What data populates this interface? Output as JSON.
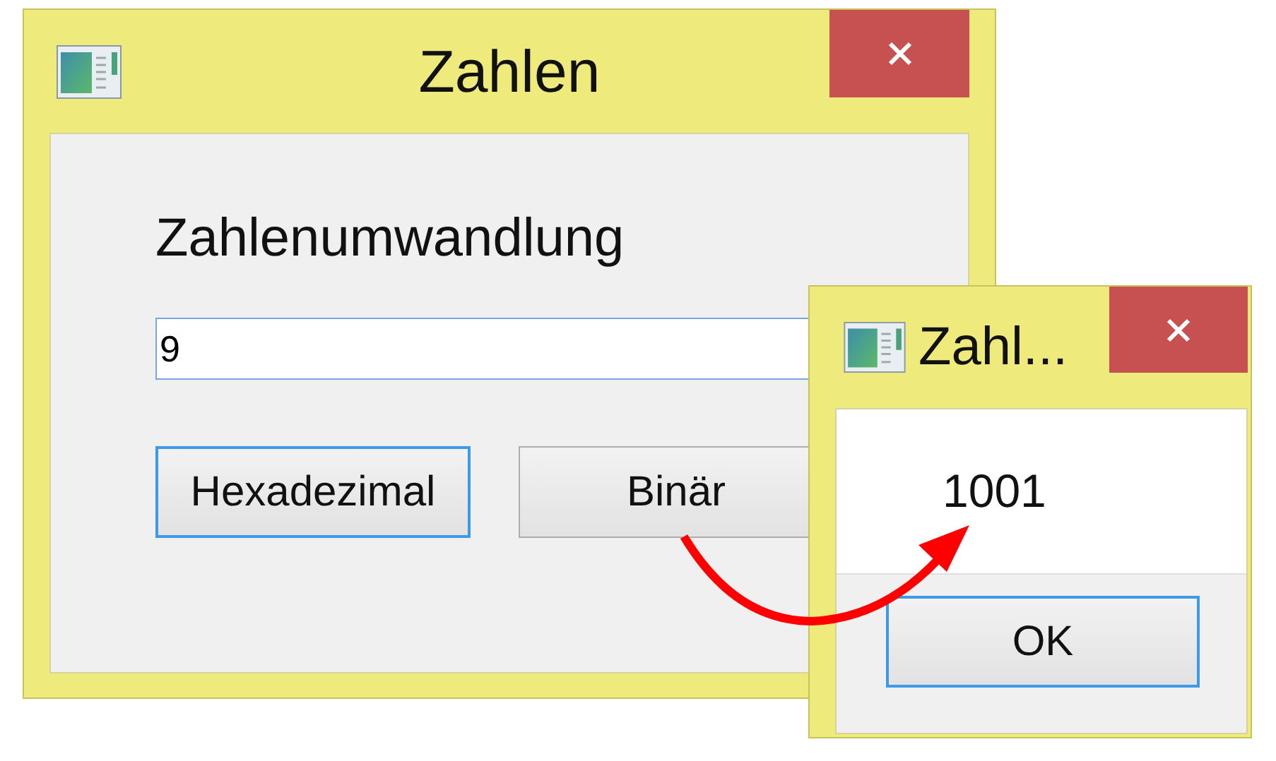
{
  "main_window": {
    "title": "Zahlen",
    "heading": "Zahlenumwandlung",
    "input": {
      "value": "9"
    },
    "buttons": [
      {
        "label": "Hexadezimal",
        "selected": true
      },
      {
        "label": "Binär",
        "selected": false
      }
    ]
  },
  "message_box": {
    "title": "Zahl...",
    "message": "1001",
    "buttons": [
      {
        "label": "OK",
        "selected": true
      }
    ]
  }
}
